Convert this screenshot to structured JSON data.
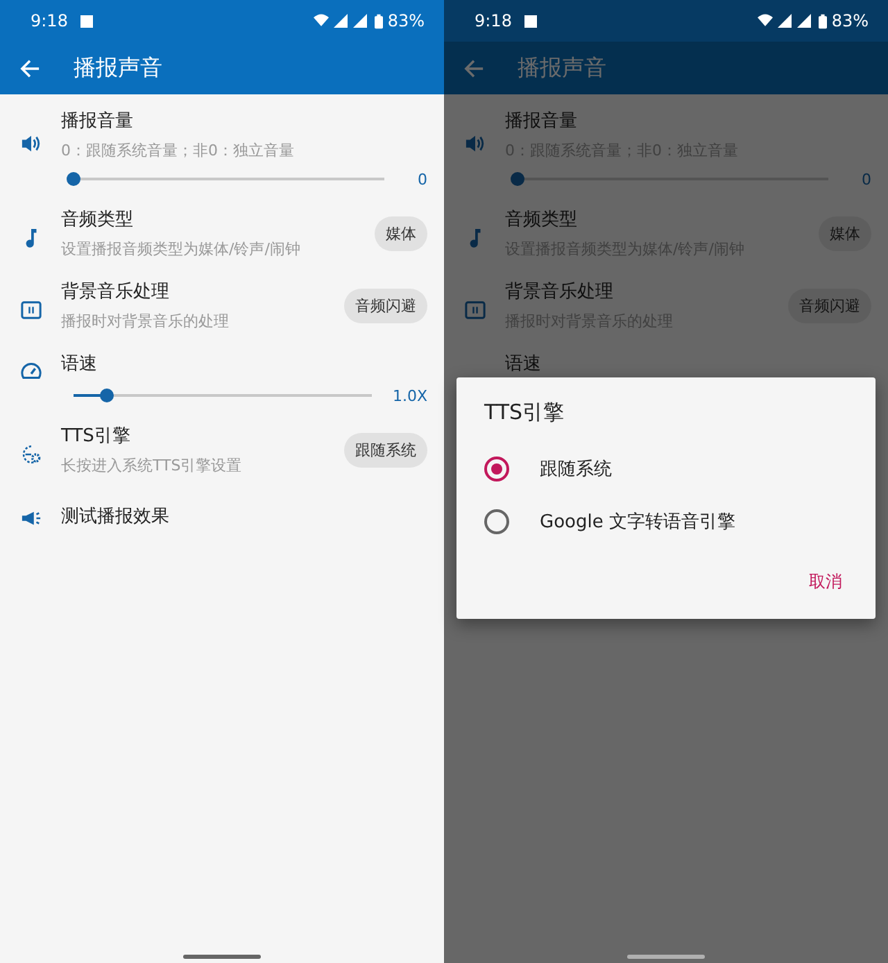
{
  "screens": [
    {
      "dimmed": false,
      "status_bar": {
        "time": "9:18",
        "battery": "83%"
      },
      "title": "播报声音",
      "settings": [
        {
          "kind": "slider",
          "title": "播报音量",
          "subtitle": "0：跟随系统音量；非0：独立音量",
          "level": 0,
          "reading": "0"
        },
        {
          "kind": "chip",
          "title": "音频类型",
          "subtitle": "设置播报音频类型为媒体/铃声/闹钟",
          "value": "媒体"
        },
        {
          "kind": "chip",
          "title": "背景音乐处理",
          "subtitle": "播报时对背景音乐的处理",
          "value": "音频闪避"
        },
        {
          "kind": "slider",
          "title": "语速",
          "level": 0.11,
          "reading": "1.0X"
        },
        {
          "kind": "chip",
          "title": "TTS引擎",
          "subtitle": "长按进入系统TTS引擎设置",
          "value": "跟随系统"
        },
        {
          "kind": "action",
          "title": "测试播报效果"
        }
      ]
    },
    {
      "dimmed": true,
      "status_bar": {
        "time": "9:18",
        "battery": "83%"
      },
      "title": "播报声音",
      "settings": [
        {
          "kind": "slider",
          "title": "播报音量",
          "subtitle": "0：跟随系统音量；非0：独立音量",
          "level": 0,
          "reading": "0"
        },
        {
          "kind": "chip",
          "title": "音频类型",
          "subtitle": "设置播报音频类型为媒体/铃声/闹钟",
          "value": "媒体"
        },
        {
          "kind": "chip",
          "title": "背景音乐处理",
          "subtitle": "播报时对背景音乐的处理",
          "value": "音频闪避"
        },
        {
          "kind": "title",
          "title": "语速"
        }
      ],
      "dialog": {
        "title": "TTS引擎",
        "options": [
          {
            "label": "跟随系统",
            "selected": true
          },
          {
            "label": "Google 文字转语音引擎",
            "selected": false
          }
        ],
        "button": "取消"
      }
    }
  ]
}
